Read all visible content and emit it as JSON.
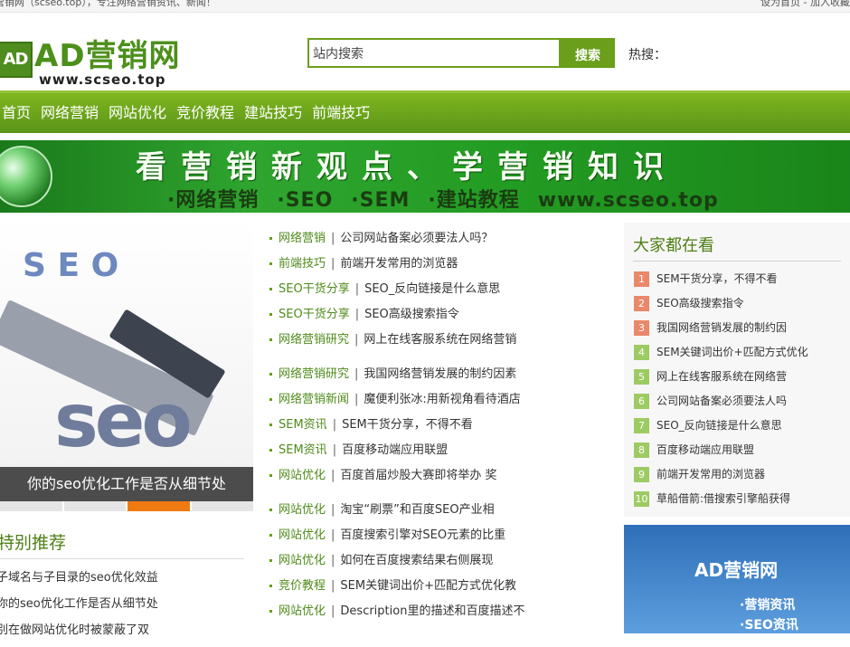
{
  "topbar": {
    "intro": "营销网（scseo.top），专注网络营销资讯、新闻！",
    "links": "设为首页 - 加入收藏"
  },
  "logo": {
    "box": "AD",
    "main": "AD营销网",
    "url": "www.scseo.top"
  },
  "search": {
    "placeholder": "站内搜索",
    "button": "搜索",
    "hot_label": "热搜："
  },
  "nav": {
    "items": [
      "首页",
      "网络营销",
      "网站优化",
      "竞价教程",
      "建站技巧",
      "前端技巧"
    ]
  },
  "banner": {
    "slogan": "看营销新观点、学营销知识",
    "sub": [
      "·网络营销",
      "·SEO",
      "·SEM",
      "·建站教程",
      "www.scseo.top"
    ]
  },
  "slide": {
    "letters": "S  E  O",
    "word": "seo",
    "caption": "你的seo优化工作是否从细节处"
  },
  "recommend": {
    "title": "特别推荐",
    "items": [
      "子域名与子目录的seo优化效益",
      "你的seo优化工作是否从细节处",
      "别在做网站优化时被蒙蔽了双"
    ]
  },
  "news": [
    {
      "cat": "网络营销",
      "title": "公司网站备案必须要法人吗？"
    },
    {
      "cat": "前端技巧",
      "title": "前端开发常用的浏览器"
    },
    {
      "cat": "SEO干货分享",
      "title": "SEO_反向链接是什么意思"
    },
    {
      "cat": "SEO干货分享",
      "title": "SEO高级搜索指令"
    },
    {
      "cat": "网络营销研究",
      "title": "网上在线客服系统在网络营销"
    },
    {
      "cat": "网络营销研究",
      "title": "我国网络营销发展的制约因素"
    },
    {
      "cat": "网络营销新闻",
      "title": "魔便利张冰:用新视角看待酒店"
    },
    {
      "cat": "SEM资讯",
      "title": "SEM干货分享，不得不看"
    },
    {
      "cat": "SEM资讯",
      "title": "百度移动端应用联盟"
    },
    {
      "cat": "网站优化",
      "title": "百度首届炒股大赛即将举办 奖"
    },
    {
      "cat": "网站优化",
      "title": "淘宝“刷票”和百度SEO产业相"
    },
    {
      "cat": "网站优化",
      "title": "百度搜索引擎对SEO元素的比重"
    },
    {
      "cat": "网站优化",
      "title": "如何在百度搜索结果右侧展现"
    },
    {
      "cat": "竞价教程",
      "title": "SEM关键词出价+匹配方式优化教"
    },
    {
      "cat": "网站优化",
      "title": "Description里的描述和百度描述不"
    }
  ],
  "popular": {
    "title": "大家都在看",
    "colors": {
      "top": "#e9886a",
      "rest": "#9dcb63"
    },
    "items": [
      {
        "n": "1",
        "title": "SEM干货分享，不得不看"
      },
      {
        "n": "2",
        "title": "SEO高级搜索指令"
      },
      {
        "n": "3",
        "title": "我国网络营销发展的制约因"
      },
      {
        "n": "4",
        "title": "SEM关键词出价+匹配方式优化"
      },
      {
        "n": "5",
        "title": "网上在线客服系统在网络营"
      },
      {
        "n": "6",
        "title": "公司网站备案必须要法人吗"
      },
      {
        "n": "7",
        "title": "SEO_反向链接是什么意思"
      },
      {
        "n": "8",
        "title": "百度移动端应用联盟"
      },
      {
        "n": "9",
        "title": "前端开发常用的浏览器"
      },
      {
        "n": "10",
        "title": "草船借箭:借搜索引擎船获得"
      }
    ]
  },
  "ad": {
    "title": "AD营销网",
    "l1": "·营销资讯",
    "l2": "·SEO资讯"
  }
}
